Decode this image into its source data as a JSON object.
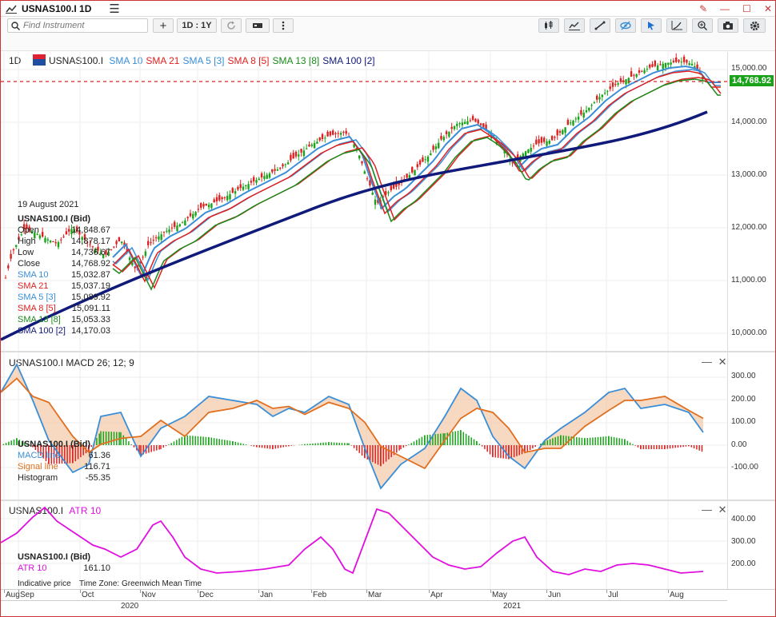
{
  "window": {
    "title": "USNAS100.I 1D",
    "menu_icon": "hamburger-icon"
  },
  "toolbar": {
    "search_placeholder": "Find Instrument",
    "add_label": "+",
    "period_label": "1D : 1Y",
    "icons": [
      "refresh-icon",
      "chart-type-icon",
      "more-icon",
      "candles-icon",
      "indicators-icon",
      "drawing-icon",
      "visibility-icon",
      "cursor-icon",
      "trendline-icon",
      "zoom-icon",
      "camera-icon",
      "settings-icon"
    ]
  },
  "main": {
    "timeframe": "1D",
    "symbol": "USNAS100.I",
    "legend": [
      {
        "label": "SMA 10",
        "color": "#3a8ed8"
      },
      {
        "label": "SMA 21",
        "color": "#e02020"
      },
      {
        "label": "SMA 5 [3]",
        "color": "#3a8ed8"
      },
      {
        "label": "SMA 8 [5]",
        "color": "#e02020"
      },
      {
        "label": "SMA 13 [8]",
        "color": "#1a8a1a"
      },
      {
        "label": "SMA 100 [2]",
        "color": "#101a7a"
      }
    ],
    "price_tag": "14,768.92",
    "yticks": [
      "15,000.00",
      "14,000.00",
      "13,000.00",
      "12,000.00",
      "11,000.00",
      "10,000.00"
    ],
    "info": {
      "date": "19 August 2021",
      "title": "USNAS100.I (Bid)",
      "rows": [
        {
          "k": "Open",
          "v": "14,848.67",
          "color": "#222"
        },
        {
          "k": "High",
          "v": "14,878.17",
          "color": "#222"
        },
        {
          "k": "Low",
          "v": "14,736.67",
          "color": "#222"
        },
        {
          "k": "Close",
          "v": "14,768.92",
          "color": "#222"
        },
        {
          "k": "SMA 10",
          "v": "15,032.87",
          "color": "#3a8ed8"
        },
        {
          "k": "SMA 21",
          "v": "15,037.19",
          "color": "#e02020"
        },
        {
          "k": "SMA 5 [3]",
          "v": "15,089.92",
          "color": "#3a8ed8"
        },
        {
          "k": "SMA 8 [5]",
          "v": "15,091.11",
          "color": "#e02020"
        },
        {
          "k": "SMA 13 [8]",
          "v": "15,053.33",
          "color": "#1a8a1a"
        },
        {
          "k": "SMA 100 [2]",
          "v": "14,170.03",
          "color": "#101a7a"
        }
      ]
    }
  },
  "macd": {
    "label": "USNAS100.I  MACD 26; 12; 9",
    "yticks": [
      "300.00",
      "200.00",
      "100.00",
      "0.00",
      "-100.00"
    ],
    "info_title": "USNAS100.I (Bid)",
    "rows": [
      {
        "k": "MACD line",
        "v": "61.36",
        "color": "#3a8ed8"
      },
      {
        "k": "Signal line",
        "v": "116.71",
        "color": "#e07020"
      },
      {
        "k": "Histogram",
        "v": "-55.35",
        "color": "#222"
      }
    ]
  },
  "atr": {
    "label_symbol": "USNAS100.I",
    "label_ind": "ATR 10",
    "yticks": [
      "400.00",
      "300.00",
      "200.00"
    ],
    "info_title": "USNAS100.I (Bid)",
    "row": {
      "k": "ATR 10",
      "v": "161.10"
    }
  },
  "footer": {
    "indicative": "Indicative price",
    "timezone": "Time Zone: Greenwich Mean Time",
    "months": [
      "Aug",
      "Sep",
      "Oct",
      "Nov",
      "Dec",
      "Jan",
      "Feb",
      "Mar",
      "Apr",
      "May",
      "Jun",
      "Jul",
      "Aug"
    ],
    "years": [
      "2020",
      "2021"
    ]
  }
}
